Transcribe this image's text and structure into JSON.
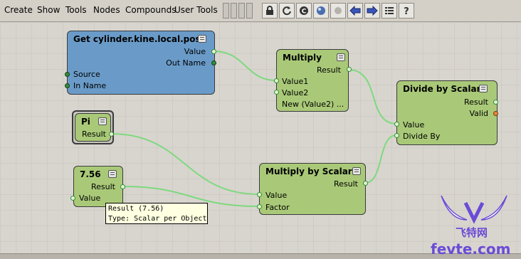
{
  "menubar": {
    "items": [
      "Create",
      "Show",
      "Tools",
      "Nodes",
      "Compounds",
      "User Tools"
    ]
  },
  "toolbar": {
    "buttons": [
      "lock-icon",
      "refresh-icon",
      "copy-icon",
      "globe-icon",
      "stop-icon",
      "back-arrow-icon",
      "forward-arrow-icon",
      "list-icon",
      "help-icon"
    ]
  },
  "nodes": {
    "get_cylinder": {
      "title": "Get cylinder.kine.local.posx",
      "outputs": [
        "Value",
        "Out Name"
      ],
      "inputs": [
        "Source",
        "In Name"
      ]
    },
    "multiply": {
      "title": "Multiply",
      "output": "Result",
      "inputs": [
        "Value1",
        "Value2",
        "New (Value2) ..."
      ]
    },
    "divide": {
      "title": "Divide by Scalar",
      "outputs": [
        "Result",
        "Valid"
      ],
      "inputs": [
        "Value",
        "Divide By"
      ]
    },
    "pi": {
      "title": "Pi",
      "output": "Result"
    },
    "const756": {
      "title": "7.56",
      "output": "Result",
      "input": "Value"
    },
    "multiply_scalar": {
      "title": "Multiply by Scalar",
      "output": "Result",
      "inputs": [
        "Value",
        "Factor"
      ]
    }
  },
  "tooltip": {
    "line1": "Result (7.56)",
    "line2": "Type: Scalar per Object"
  },
  "watermark": {
    "brand": "飞特网",
    "site": "fevte.com"
  },
  "colors": {
    "node_blue": "#6a9bc8",
    "node_green": "#a9c978",
    "wire": "#7ed97e",
    "watermark": "#6b4bd6"
  }
}
